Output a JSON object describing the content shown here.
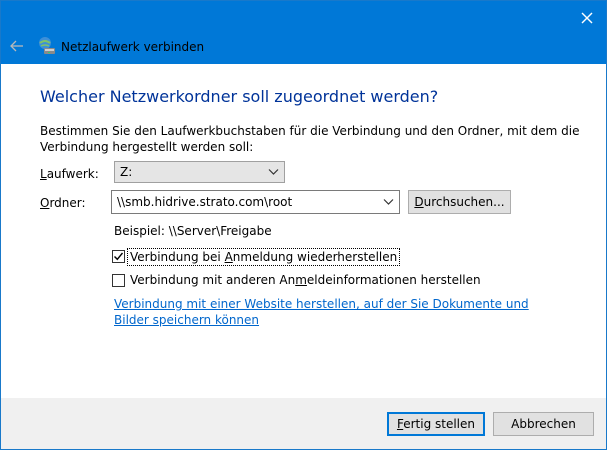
{
  "window": {
    "title": "Netzlaufwerk verbinden",
    "accent_color": "#0078d7",
    "icons": {
      "close": "close-icon",
      "back": "back-arrow-icon",
      "app": "network-drive-icon"
    }
  },
  "main": {
    "heading": "Welcher Netzwerkordner soll zugeordnet werden?",
    "description": "Bestimmen Sie den Laufwerkbuchstaben für die Verbindung und den Ordner, mit dem die Verbindung hergestellt werden soll:"
  },
  "drive": {
    "label_access": "L",
    "label_rest": "aufwerk:",
    "value": "Z:"
  },
  "folder": {
    "label_access": "O",
    "label_rest": "rdner:",
    "value": "\\\\smb.hidrive.strato.com\\root",
    "browse_access": "D",
    "browse_rest": "urchsuchen..."
  },
  "example": "Beispiel: \\\\Server\\Freigabe",
  "options": {
    "reconnect": {
      "checked": true,
      "pre": "Verbindung bei ",
      "access": "A",
      "post": "nmeldung wiederherstellen"
    },
    "other_credentials": {
      "checked": false,
      "pre": "Verbindung mit anderen An",
      "access": "m",
      "post": "eldeinformationen herstellen"
    }
  },
  "link_text": "Verbindung mit einer Website herstellen, auf der Sie Dokumente und Bilder speichern können",
  "footer": {
    "finish_access": "F",
    "finish_rest": "ertig stellen",
    "cancel": "Abbrechen"
  }
}
